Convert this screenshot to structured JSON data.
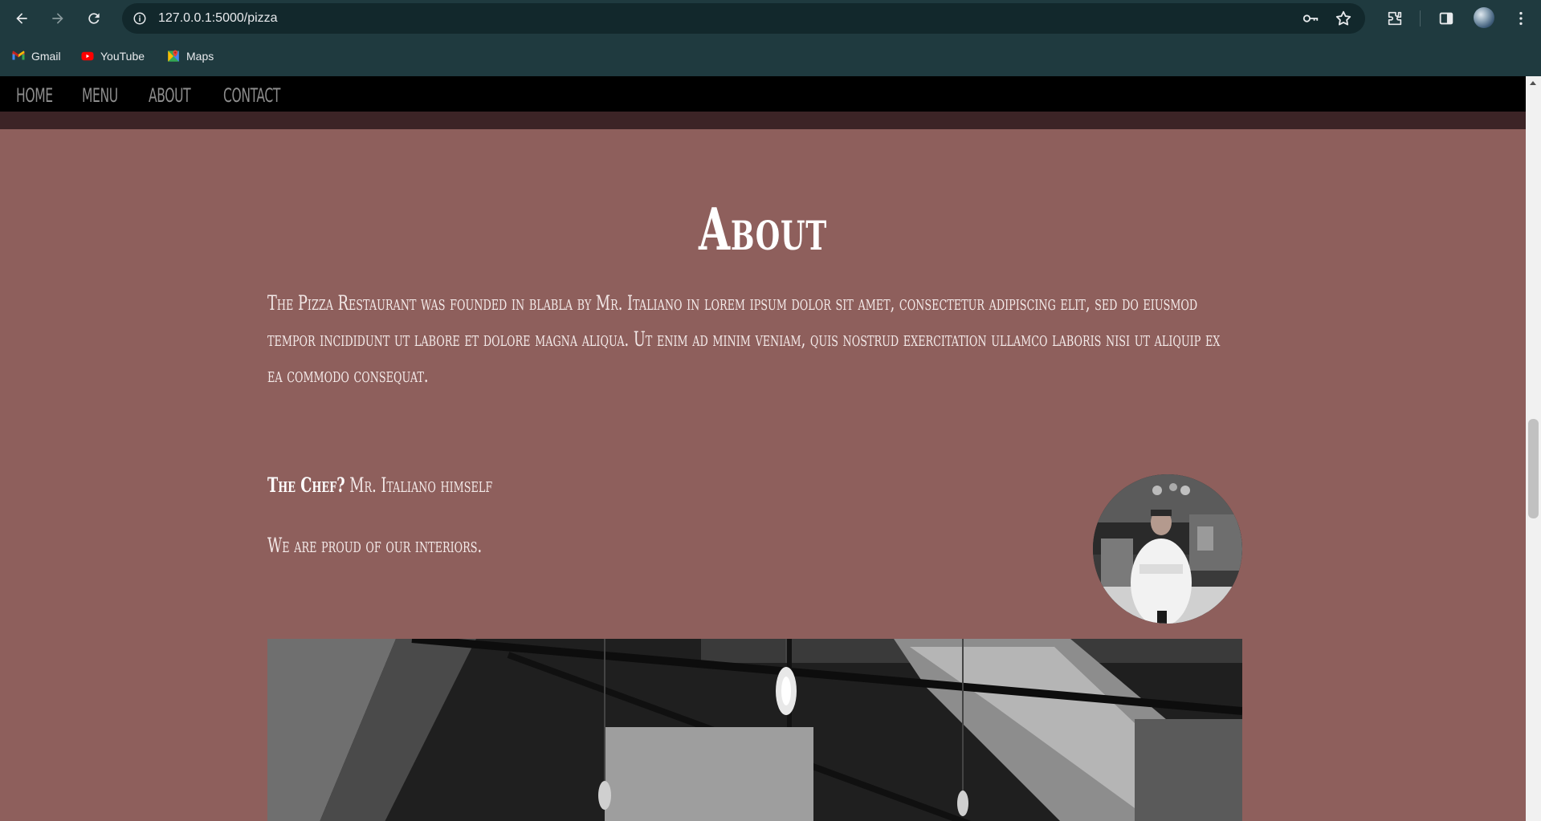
{
  "browser": {
    "url": "127.0.0.1:5000/pizza",
    "bookmarks": [
      {
        "label": "Gmail",
        "icon": "gmail-icon"
      },
      {
        "label": "YouTube",
        "icon": "youtube-icon"
      },
      {
        "label": "Maps",
        "icon": "maps-icon"
      }
    ]
  },
  "site": {
    "nav": [
      {
        "label": "HOME"
      },
      {
        "label": "MENU"
      },
      {
        "label": "ABOUT"
      },
      {
        "label": "CONTACT"
      }
    ],
    "about": {
      "title": "About",
      "paragraph": "The Pizza Restaurant was founded in blabla by Mr. Italiano in lorem ipsum dolor sit amet, consectetur adipiscing elit, sed do eiusmod tempor incididunt ut labore et dolore magna aliqua. Ut enim ad minim veniam, quis nostrud exercitation ullamco laboris nisi ut aliquip ex ea commodo consequat.",
      "chef_label": "The Chef?",
      "chef_name": " Mr. Italiano himself",
      "interiors": "We are proud of our interiors."
    }
  },
  "colors": {
    "page_bg": "#8e5f5c",
    "nav_bg": "#000000",
    "nav_text": "#8d8d8d",
    "chrome_bg": "#1f3a3f"
  }
}
